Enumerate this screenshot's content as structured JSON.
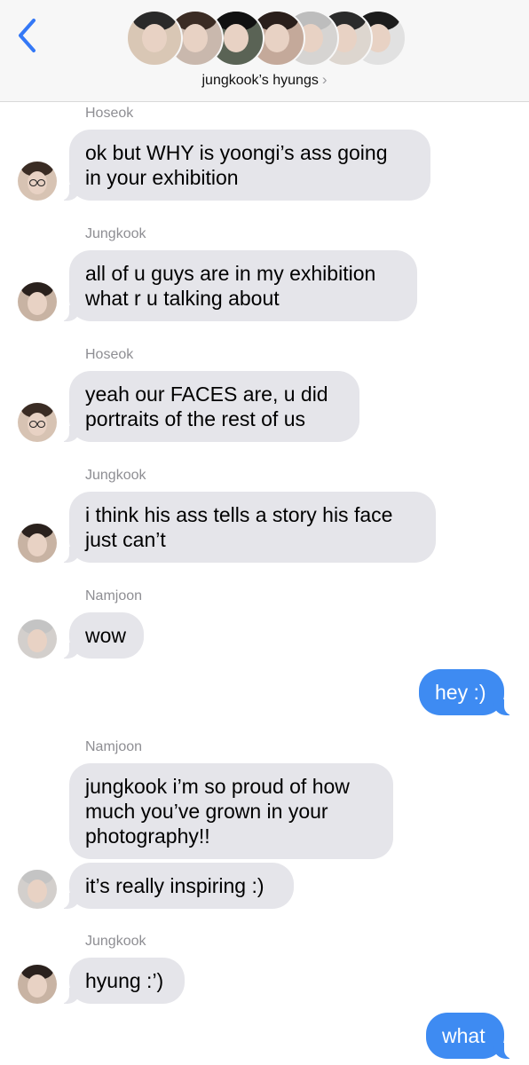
{
  "header": {
    "back_icon": "chevron-left-icon",
    "title": "jungkook’s hyungs",
    "title_chevron": "›",
    "accent": "#3478f6",
    "avatars": [
      {
        "name": "group-avatar-1",
        "bg": "#d9c7b5",
        "hair": "#2a2a2a"
      },
      {
        "name": "group-avatar-2",
        "bg": "#c9b8ad",
        "hair": "#3b2c24"
      },
      {
        "name": "group-avatar-3",
        "bg": "#5a6355",
        "hair": "#111111"
      },
      {
        "name": "group-avatar-4",
        "bg": "#c4a99a",
        "hair": "#2a1f1b"
      },
      {
        "name": "group-avatar-5",
        "bg": "#d6d4d2",
        "hair": "#bdbdbd"
      },
      {
        "name": "group-avatar-6",
        "bg": "#ddd6cf",
        "hair": "#2b2b2b"
      },
      {
        "name": "group-avatar-7",
        "bg": "#e1e1e1",
        "hair": "#1c1c1c"
      }
    ]
  },
  "messages": [
    {
      "sender": "Hoseok",
      "lines": [
        "ok but WHY is yoongi’s ass going",
        "in your exhibition"
      ],
      "direction": "in"
    },
    {
      "sender": "Jungkook",
      "lines": [
        "all of u guys are in my exhibition",
        "what r u talking about"
      ],
      "direction": "in"
    },
    {
      "sender": "Hoseok",
      "lines": [
        "yeah our FACES are, u did",
        "portraits of the rest of us"
      ],
      "direction": "in"
    },
    {
      "sender": "Jungkook",
      "lines": [
        "i think his ass tells a story his face",
        "just can’t"
      ],
      "direction": "in"
    },
    {
      "sender": "Namjoon",
      "lines": [
        "wow"
      ],
      "direction": "in"
    },
    {
      "sender": "",
      "lines": [
        "hey :)"
      ],
      "direction": "out"
    },
    {
      "sender": "Namjoon",
      "lines": [
        "jungkook i’m so proud of how",
        "much you’ve grown in your",
        "photography!!"
      ],
      "direction": "in"
    },
    {
      "sender": "",
      "lines": [
        "it’s really inspiring :)"
      ],
      "direction": "in"
    },
    {
      "sender": "Jungkook",
      "lines": [
        "hyung :’)"
      ],
      "direction": "in"
    },
    {
      "sender": "",
      "lines": [
        "what"
      ],
      "direction": "out"
    }
  ],
  "colors": {
    "incoming_bubble": "#e5e5ea",
    "outgoing_bubble": "#3e8bf2",
    "sender_label": "#8e8e93"
  },
  "avatar_styles": {
    "hoseok": {
      "bg": "#d7c3b3",
      "hair": "#3a2c24",
      "glasses": true
    },
    "jungkook": {
      "bg": "#c8b3a3",
      "hair": "#2a211d",
      "glasses": false
    },
    "namjoon": {
      "bg": "#d3cfcc",
      "hair": "#c4c4c4",
      "glasses": false
    }
  }
}
